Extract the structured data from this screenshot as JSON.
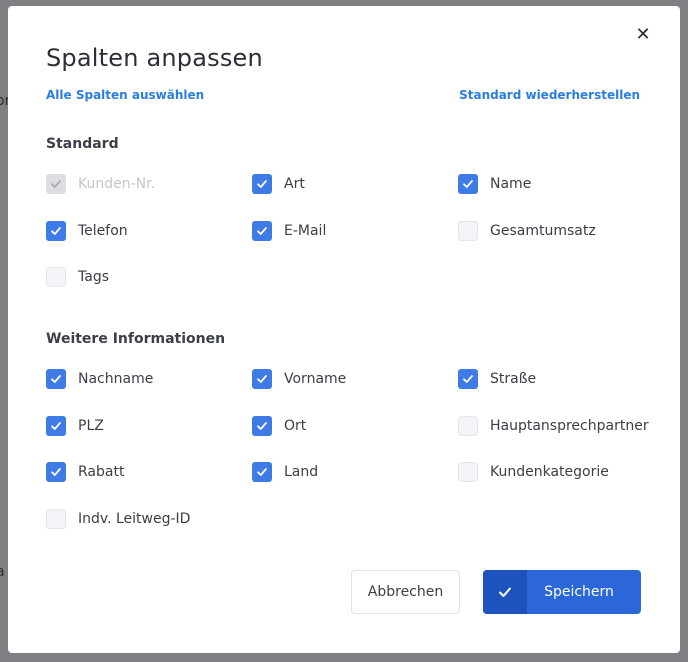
{
  "background": {
    "left_fragment": "or",
    "left_fragment_2": "a"
  },
  "dialog": {
    "title": "Spalten anpassen",
    "select_all_link": "Alle Spalten auswählen",
    "reset_link": "Standard wiederherstellen",
    "close_icon": "close-icon",
    "sections": [
      {
        "title": "Standard",
        "items": [
          {
            "label": "Kunden-Nr.",
            "checked": true,
            "disabled": true
          },
          {
            "label": "Art",
            "checked": true,
            "disabled": false
          },
          {
            "label": "Name",
            "checked": true,
            "disabled": false
          },
          {
            "label": "Telefon",
            "checked": true,
            "disabled": false
          },
          {
            "label": "E-Mail",
            "checked": true,
            "disabled": false
          },
          {
            "label": "Gesamtumsatz",
            "checked": false,
            "disabled": false
          },
          {
            "label": "Tags",
            "checked": false,
            "disabled": false
          }
        ]
      },
      {
        "title": "Weitere Informationen",
        "items": [
          {
            "label": "Nachname",
            "checked": true,
            "disabled": false
          },
          {
            "label": "Vorname",
            "checked": true,
            "disabled": false
          },
          {
            "label": "Straße",
            "checked": true,
            "disabled": false
          },
          {
            "label": "PLZ",
            "checked": true,
            "disabled": false
          },
          {
            "label": "Ort",
            "checked": true,
            "disabled": false
          },
          {
            "label": "Hauptansprechpartner",
            "checked": false,
            "disabled": false
          },
          {
            "label": "Rabatt",
            "checked": true,
            "disabled": false
          },
          {
            "label": "Land",
            "checked": true,
            "disabled": false
          },
          {
            "label": "Kundenkategorie",
            "checked": false,
            "disabled": false
          },
          {
            "label": "Indv. Leitweg-ID",
            "checked": false,
            "disabled": false
          }
        ]
      }
    ],
    "buttons": {
      "cancel_label": "Abbrechen",
      "save_label": "Speichern",
      "save_icon": "check-icon"
    }
  },
  "colors": {
    "accent": "#3e7be6",
    "link": "#2a7de1",
    "save_button": "#2b67d8",
    "save_icon_bg": "#1d53bd",
    "overlay": "#7d7f82"
  }
}
